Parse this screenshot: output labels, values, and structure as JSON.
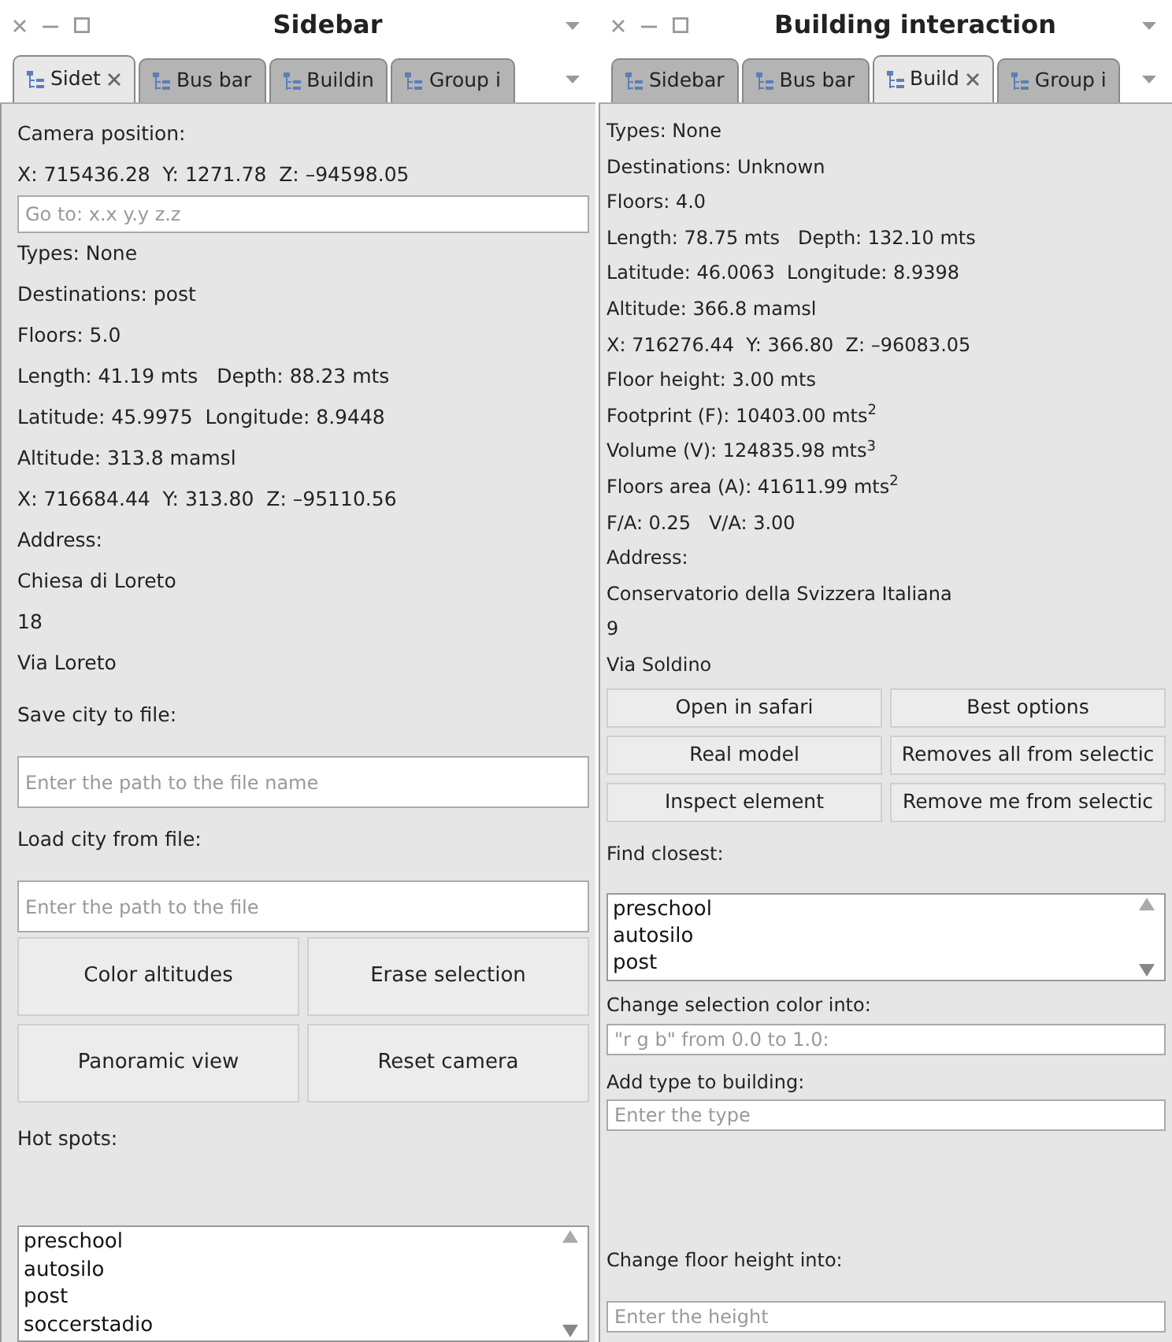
{
  "panels": [
    {
      "title": "Sidebar",
      "tabs": [
        {
          "label": "Sidet",
          "selected": true
        },
        {
          "label": "Bus bar",
          "selected": false
        },
        {
          "label": "Buildin",
          "selected": false
        },
        {
          "label": "Group i",
          "selected": false
        }
      ],
      "sections": [
        {
          "kind": "text",
          "text": "Camera position:"
        },
        {
          "kind": "text",
          "text": "X: 715436.28  Y: 1271.78  Z: –94598.05"
        },
        {
          "kind": "field",
          "placeholder": "Go to: x.x y.y z.z"
        },
        {
          "kind": "text",
          "text": "Types: None"
        },
        {
          "kind": "text",
          "text": "Destinations: post"
        },
        {
          "kind": "text",
          "text": "Floors: 5.0"
        },
        {
          "kind": "text",
          "text": "Length: 41.19 mts   Depth: 88.23 mts"
        },
        {
          "kind": "text",
          "text": "Latitude: 45.9975  Longitude: 8.9448"
        },
        {
          "kind": "text",
          "text": "Altitude: 313.8 mamsl"
        },
        {
          "kind": "text",
          "text": "X: 716684.44  Y: 313.80  Z: –95110.56"
        },
        {
          "kind": "text",
          "text": "Address:"
        },
        {
          "kind": "text",
          "text": "Chiesa di Loreto"
        },
        {
          "kind": "text",
          "text": "18"
        },
        {
          "kind": "text",
          "text": "Via Loreto"
        },
        {
          "kind": "heading",
          "text": "Save city to file:"
        },
        {
          "kind": "field",
          "placeholder": "Enter the path to the file name"
        },
        {
          "kind": "heading",
          "text": "Load city from file:"
        },
        {
          "kind": "field",
          "placeholder": "Enter the path to the file"
        },
        {
          "kind": "buttons",
          "buttons": [
            "Color altitudes",
            "Erase selection",
            "Panoramic view",
            "Reset camera"
          ]
        },
        {
          "kind": "heading",
          "text": "Hot spots:"
        },
        {
          "kind": "list",
          "items": [
            "preschool",
            "autosilo",
            "post",
            "soccerstadio"
          ]
        }
      ]
    },
    {
      "title": "Building interaction",
      "tabs": [
        {
          "label": "Sidebar",
          "selected": false
        },
        {
          "label": "Bus bar",
          "selected": false
        },
        {
          "label": "Build",
          "selected": true
        },
        {
          "label": "Group i",
          "selected": false
        }
      ],
      "sections": [
        {
          "kind": "text",
          "text": "Types: None"
        },
        {
          "kind": "text",
          "text": "Destinations: Unknown"
        },
        {
          "kind": "text",
          "text": "Floors: 4.0"
        },
        {
          "kind": "text",
          "text": "Length: 78.75 mts   Depth: 132.10 mts"
        },
        {
          "kind": "text",
          "text": "Latitude: 46.0063  Longitude: 8.9398"
        },
        {
          "kind": "text",
          "text": "Altitude: 366.8 mamsl"
        },
        {
          "kind": "text",
          "text": "X: 716276.44  Y: 366.80  Z: –96083.05"
        },
        {
          "kind": "text",
          "text": "Floor height: 3.00 mts"
        },
        {
          "kind": "text",
          "text": "Footprint (F): 10403.00 mts$^{2}$"
        },
        {
          "kind": "text",
          "text": "Volume (V): 124835.98 mts$^{3}$"
        },
        {
          "kind": "text",
          "text": "Floors area (A): 41611.99 mts$^{2}$"
        },
        {
          "kind": "text",
          "text": "F/A: 0.25   V/A: 3.00"
        },
        {
          "kind": "text",
          "text": "Address:"
        },
        {
          "kind": "text",
          "text": "Conservatorio della Svizzera Italiana"
        },
        {
          "kind": "text",
          "text": "9"
        },
        {
          "kind": "text",
          "text": "Via Soldino"
        },
        {
          "kind": "buttons",
          "buttons": [
            "Open in safari",
            "Best options",
            "Real model",
            "Removes all from selectic",
            "Inspect element",
            "Remove me from selectic"
          ]
        },
        {
          "kind": "heading",
          "text": "Find closest:"
        },
        {
          "kind": "list",
          "items": [
            "preschool",
            "autosilo",
            "post"
          ]
        },
        {
          "kind": "text",
          "text": "Change selection color into:"
        },
        {
          "kind": "field",
          "placeholder": "\"r g b\" from 0.0 to 1.0:"
        },
        {
          "kind": "text",
          "text": "Add type to building:"
        },
        {
          "kind": "field",
          "placeholder": "Enter the type"
        },
        {
          "kind": "heading",
          "text": "Change floor height into:"
        },
        {
          "kind": "field",
          "placeholder": "Enter the height"
        }
      ]
    }
  ]
}
